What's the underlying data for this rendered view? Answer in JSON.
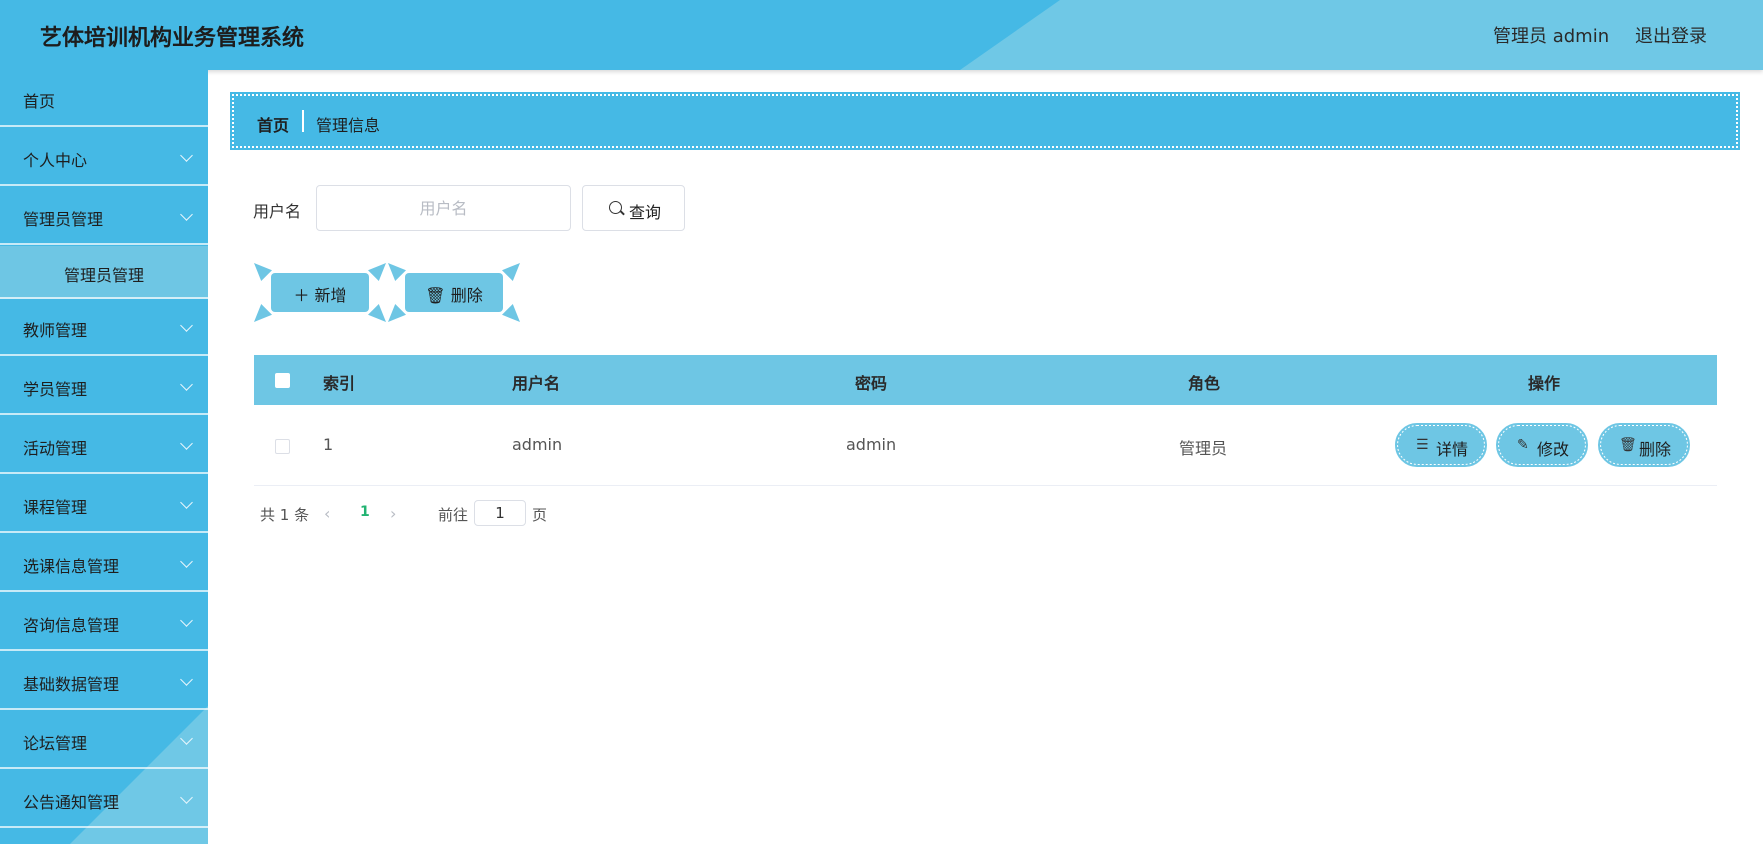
{
  "header": {
    "title": "艺体培训机构业务管理系统",
    "user": "管理员 admin",
    "logout": "退出登录"
  },
  "sidebar": {
    "items": [
      {
        "label": "首页"
      },
      {
        "label": "个人中心"
      },
      {
        "label": "管理员管理"
      },
      {
        "label": "管理员管理"
      },
      {
        "label": "教师管理"
      },
      {
        "label": "学员管理"
      },
      {
        "label": "活动管理"
      },
      {
        "label": "课程管理"
      },
      {
        "label": "选课信息管理"
      },
      {
        "label": "咨询信息管理"
      },
      {
        "label": "基础数据管理"
      },
      {
        "label": "论坛管理"
      },
      {
        "label": "公告通知管理"
      }
    ]
  },
  "breadcrumb": {
    "home": "首页",
    "current": "管理信息"
  },
  "search": {
    "label": "用户名",
    "placeholder": "用户名",
    "value": "",
    "button": "查询"
  },
  "actions": {
    "add": "新增",
    "delete": "删除"
  },
  "table": {
    "headers": {
      "index": "索引",
      "username": "用户名",
      "password": "密码",
      "role": "角色",
      "ops": "操作"
    },
    "rows": [
      {
        "index": "1",
        "username": "admin",
        "password": "admin",
        "role": "管理员"
      }
    ],
    "row_buttons": {
      "detail": "详情",
      "edit": "修改",
      "delete": "删除"
    }
  },
  "pagination": {
    "total": "共 1 条",
    "current_page": "1",
    "goto": "前往",
    "goto_value": "1",
    "page_suffix": "页"
  },
  "colors": {
    "primary": "#45b9e5",
    "light": "#6ec6e4",
    "active_page": "#22b372"
  }
}
